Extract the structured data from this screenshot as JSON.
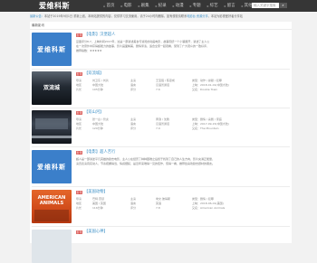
{
  "header": {
    "logo": "爱维科斯",
    "nav": [
      {
        "icon": "⌂",
        "label": "首页"
      },
      {
        "icon": "▸",
        "label": "电影"
      },
      {
        "icon": "▸",
        "label": "剧集"
      },
      {
        "icon": "▸",
        "label": "纪录"
      },
      {
        "icon": "▸",
        "label": "动漫"
      },
      {
        "icon": "▸",
        "label": "专题"
      },
      {
        "icon": "▸",
        "label": "综艺"
      },
      {
        "icon": "▸",
        "label": "留言"
      },
      {
        "icon": "▸",
        "label": "其他"
      }
    ],
    "search_placeholder": "输入关键字搜索",
    "search_button": "搜索"
  },
  "notice": {
    "label": "最新公告:",
    "text": "本站于2019年9月1日 重新上线，本网站提供的内容，仅供学习交流使用，请于24小时内删除。如有侵权请联系",
    "link": "电影台 资源分享",
    "tail": "，本站为影视爱好者分享站"
  },
  "panel": {
    "title": "最新影讯"
  },
  "items": [
    {
      "badge": "影讯",
      "title": "【电影】汉堡超人",
      "thumb_text": "爱维科斯",
      "lines": [
        "豆瓣评分8.7，上映时间2017年，这是一部讲述美食与冒险的动画电影，故事围绕一个小镇展开，讲述了主人公",
        "在一次意外中获得超能力的故事，影片画面精美，剧情紧凑，适合全家一起观看，受到了广大观众的一致好评，",
        "推荐指数：★★★★★"
      ]
    },
    {
      "badge": "影讯",
      "title": "【双流城】",
      "thumb_text": "双流城",
      "meta": [
        [
          "导演",
          "刘卫东 / 刘兵",
          "主演",
          "王宝强 / 陈思成",
          "类型：动作 / 悬疑 / 犯罪"
        ],
        [
          "地区",
          "中国大陆",
          "语言",
          "汉语普通话",
          "上映：2018-01-01(中国大陆)"
        ],
        [
          "片长",
          "105分钟",
          "评分",
          "7.6",
          "又名：Double Town"
        ]
      ]
    },
    {
      "badge": "影讯",
      "title": "【双山河】",
      "thumb_text": "",
      "meta": [
        [
          "导演",
          "张一白 / 管虎",
          "主演",
          "黄渤 / 沈腾",
          "类型：剧情 / 喜剧 / 家庭"
        ],
        [
          "地区",
          "中国大陆",
          "语言",
          "汉语普通话",
          "上映：2017-09-15(中国大陆)"
        ],
        [
          "片长",
          "120分钟",
          "评分",
          "7.9",
          "又名：The Mountain"
        ]
      ]
    },
    {
      "badge": "影讯",
      "title": "【电影】超人苦行",
      "thumb_text": "爱维科斯",
      "lines": [
        "超人是一部讲述平凡英雄的励志电影，主人公在经历了种种困难之后终于找到了自己的人生方向，影片充满正能量，",
        "演员表演真实动人，节奏把握得当，情感细腻，是近年来难得一见的佳作，值得一看，推荐给喜欢励志题材的朋友。"
      ]
    },
    {
      "badge": "影讯",
      "title": "【美国动物】",
      "thumb_text": "AMERICAN ANIMALS",
      "meta": [
        [
          "导演",
          "巴特·雷顿",
          "主演",
          "埃文·彼得斯",
          "类型：剧情 / 犯罪"
        ],
        [
          "地区",
          "美国 / 英国",
          "语言",
          "英语",
          "上映：2018-06-01(美国)"
        ],
        [
          "片长",
          "116分钟",
          "评分",
          "7.8",
          "又名：American Animals"
        ]
      ]
    },
    {
      "badge": "影讯",
      "title": "【美国心神】",
      "thumb_text": "",
      "meta": []
    }
  ]
}
